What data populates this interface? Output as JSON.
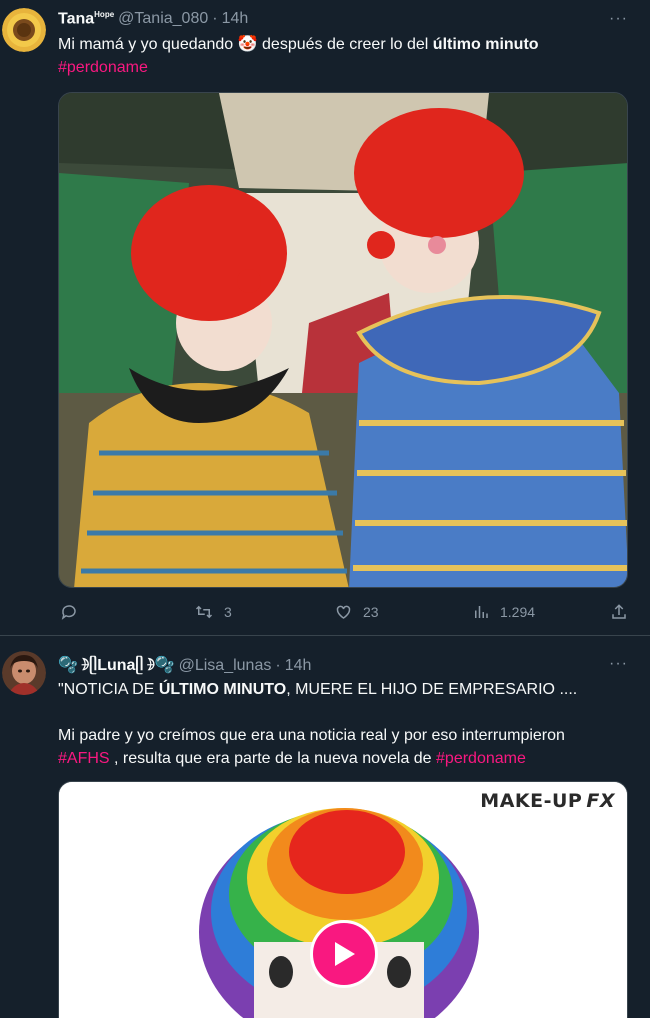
{
  "tweets": [
    {
      "display_name": "Tana",
      "name_suffix": "Hope",
      "handle": "@Tania_080",
      "separator": "·",
      "time": "14h",
      "more": "···",
      "text": {
        "part1": "Mi mamá y yo quedando ",
        "emoji": "🤡",
        "part2": " después de creer lo del ",
        "bold": "último minuto",
        "hashtag": "#perdoname"
      },
      "media_kind": "image",
      "media_description_icon": "clowns-photo",
      "actions": {
        "reply_count": "",
        "retweet_count": "3",
        "like_count": "23",
        "views_count": "1.294"
      }
    },
    {
      "display_name_prefix": "🫧☽̶",
      "display_name_core": "ᥫLunaᥫ",
      "display_name_suffix": "☽̶🫧",
      "handle": "@Lisa_lunas",
      "separator": "·",
      "time": "14h",
      "more": "···",
      "text": {
        "line1_start": "\"NOTICIA DE ",
        "line1_bold": "ÚLTIMO MINUTO",
        "line1_end": ", MUERE EL HIJO DE EMPRESARIO ....",
        "line2": "Mi padre y yo creímos que era una noticia real y por eso interrumpieron",
        "line3_hashtag1": "#AFHS",
        "line3_middle": " , resulta que era parte de la nueva novela de ",
        "line3_hashtag2": "#perdoname"
      },
      "media_kind": "video",
      "media_brand": "MAKE-UP",
      "media_brand_fx": "FX"
    }
  ],
  "colors": {
    "background": "#15202b",
    "accent": "#f91880",
    "secondary_text": "#8b98a5",
    "divider": "#38444d"
  },
  "icons": [
    "reply-icon",
    "retweet-icon",
    "like-icon",
    "views-icon",
    "share-icon",
    "play-icon",
    "more-icon"
  ]
}
